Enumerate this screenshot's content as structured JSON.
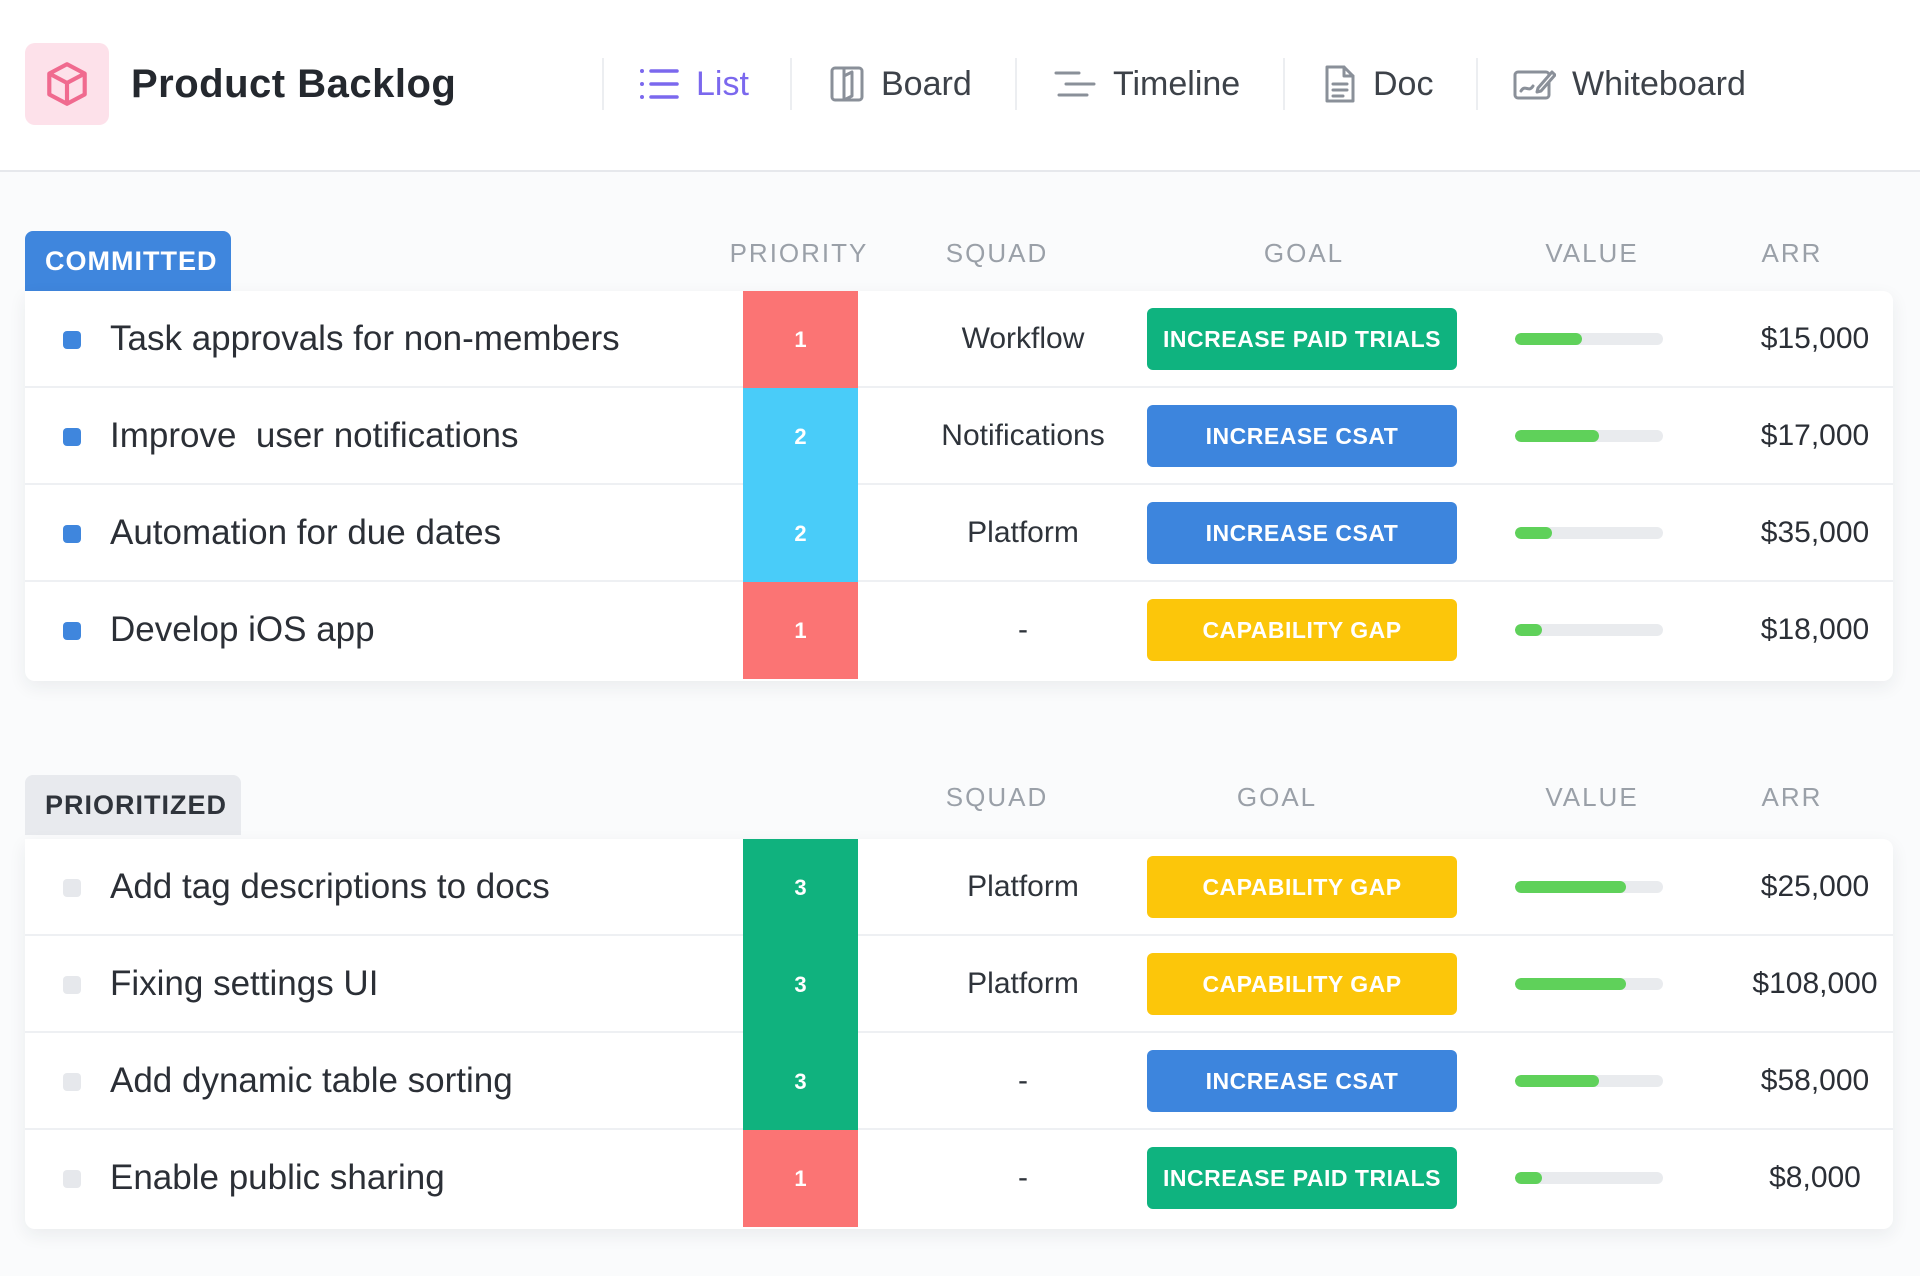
{
  "header": {
    "title": "Product Backlog",
    "icon": "cube-icon",
    "tabs": [
      {
        "label": "List",
        "icon": "list-icon",
        "active": true
      },
      {
        "label": "Board",
        "icon": "board-icon",
        "active": false
      },
      {
        "label": "Timeline",
        "icon": "timeline-icon",
        "active": false
      },
      {
        "label": "Doc",
        "icon": "doc-icon",
        "active": false
      },
      {
        "label": "Whiteboard",
        "icon": "whiteboard-icon",
        "active": false
      }
    ]
  },
  "colors": {
    "accent": "#7b68ee",
    "committed": "#3f86dd",
    "priority_1": "#fb7474",
    "priority_2": "#49ccf9",
    "priority_3": "#10b27e",
    "goal_paid_trials": "#0fb37f",
    "goal_csat": "#3d85dd",
    "goal_capability": "#fcc60a",
    "value_fill": "#5fd15a"
  },
  "groups": [
    {
      "label": "COMMITTED",
      "columns": {
        "priority": "PRIORITY",
        "squad": "SQUAD",
        "goal": "GOAL",
        "value": "VALUE",
        "arr": "ARR"
      },
      "rows": [
        {
          "name": "Task approvals for non-members",
          "priority": "1",
          "squad": "Workflow",
          "goal": "INCREASE PAID TRIALS",
          "value": 0.45,
          "arr": "$15,000"
        },
        {
          "name": "Improve  user notifications",
          "priority": "2",
          "squad": "Notifications",
          "goal": "INCREASE CSAT",
          "value": 0.57,
          "arr": "$17,000"
        },
        {
          "name": "Automation for due dates",
          "priority": "2",
          "squad": "Platform",
          "goal": "INCREASE CSAT",
          "value": 0.25,
          "arr": "$35,000"
        },
        {
          "name": "Develop iOS app",
          "priority": "1",
          "squad": "-",
          "goal": "CAPABILITY GAP",
          "value": 0.18,
          "arr": "$18,000"
        }
      ]
    },
    {
      "label": "PRIORITIZED",
      "columns": {
        "squad": "SQUAD",
        "goal": "GOAL",
        "value": "VALUE",
        "arr": "ARR"
      },
      "rows": [
        {
          "name": "Add tag descriptions to docs",
          "priority": "3",
          "squad": "Platform",
          "goal": "CAPABILITY GAP",
          "value": 0.75,
          "arr": "$25,000"
        },
        {
          "name": "Fixing settings UI",
          "priority": "3",
          "squad": "Platform",
          "goal": "CAPABILITY GAP",
          "value": 0.75,
          "arr": "$108,000"
        },
        {
          "name": "Add dynamic table sorting",
          "priority": "3",
          "squad": "-",
          "goal": "INCREASE CSAT",
          "value": 0.57,
          "arr": "$58,000"
        },
        {
          "name": "Enable public sharing",
          "priority": "1",
          "squad": "-",
          "goal": "INCREASE PAID TRIALS",
          "value": 0.18,
          "arr": "$8,000"
        }
      ]
    }
  ]
}
